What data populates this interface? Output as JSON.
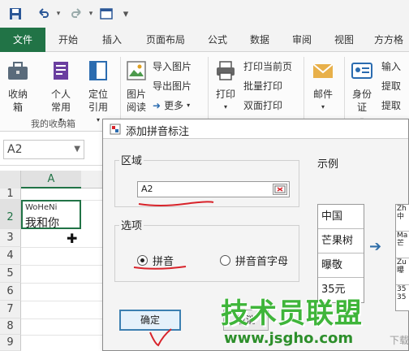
{
  "qat": {
    "customize_glyph": "▾"
  },
  "tabs": [
    "文件",
    "开始",
    "插入",
    "页面布局",
    "公式",
    "数据",
    "审阅",
    "视图",
    "方方格"
  ],
  "ribbon": {
    "collect_btn": "收纳箱",
    "group_my_collect": "我的收纳箱",
    "personal_btn": "个人常用",
    "locate_btn": "定位引用",
    "image_read_btn": "图片阅读",
    "import_image": "导入图片",
    "export_image": "导出图片",
    "more": "更多",
    "print_btn": "打印",
    "print_current_page": "打印当前页",
    "batch_print": "批量打印",
    "duplex_print": "双面打印",
    "mail_btn": "邮件",
    "id_btn": "身份证",
    "input": "输入",
    "extract1": "提取",
    "extract2": "提取"
  },
  "formula": {
    "namebox": "A2"
  },
  "grid": {
    "col_a": "A",
    "rows": [
      "1",
      "2",
      "3",
      "4",
      "5",
      "6",
      "7",
      "8",
      "9"
    ],
    "a2_pinyin": "WoHeNi",
    "a2_text": "我和你"
  },
  "dialog": {
    "title": "添加拼音标注",
    "range_label": "区域",
    "range_value": "A2",
    "options_label": "选项",
    "opt_pinyin": "拼音",
    "opt_initial": "拼音首字母",
    "ok": "确定",
    "cancel": "取消",
    "example_label": "示例",
    "example_rows": [
      "中国",
      "芒果树",
      "曝敬",
      "35元"
    ],
    "example_rows2": [
      "Zh\n中",
      "Ma\n芒",
      "Zu\n曝",
      "35\n35"
    ]
  },
  "watermark": {
    "brand": "技术员联盟",
    "url": "www.jsgho.com",
    "mark": "下载"
  },
  "colors": {
    "excel_green": "#217346",
    "annotation_red": "#d8232a",
    "watermark_green": "#3fb53a"
  }
}
